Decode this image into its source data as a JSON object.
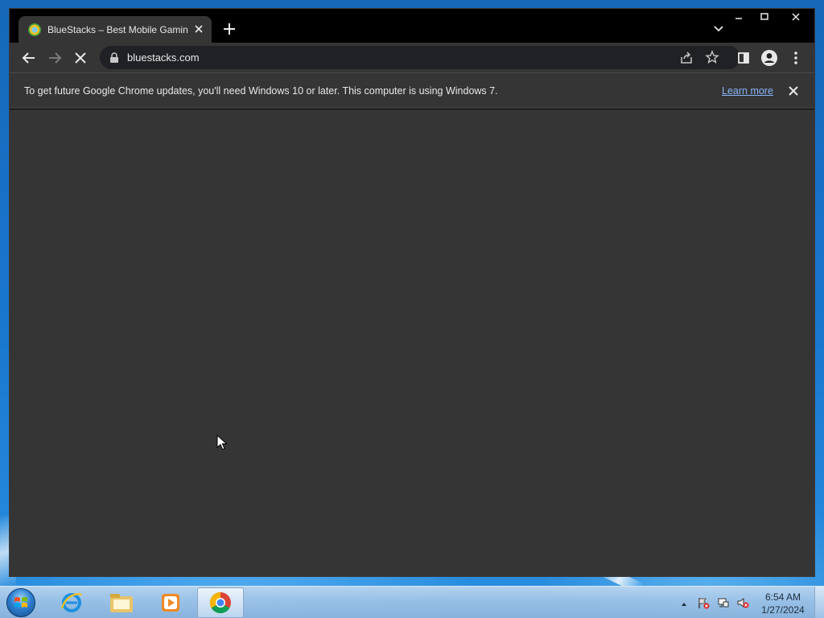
{
  "browser": {
    "tab": {
      "title": "BlueStacks – Best Mobile Gaming",
      "favicon": "bluestacks-logo-icon"
    },
    "window_controls": {
      "minimize": "—",
      "maximize": "☐",
      "close": "✕"
    },
    "toolbar": {
      "url": "bluestacks.com"
    },
    "infobar": {
      "message": "To get future Google Chrome updates, you'll need Windows 10 or later. This computer is using Windows 7.",
      "link": "Learn more"
    }
  },
  "taskbar": {
    "apps": [
      "internet-explorer-icon",
      "file-explorer-icon",
      "media-player-icon",
      "chrome-icon"
    ],
    "clock": {
      "time": "6:54 AM",
      "date": "1/27/2024"
    }
  },
  "colors": {
    "chrome_dark": "#353535",
    "omnibox": "#202124",
    "link": "#8ab4f8"
  }
}
